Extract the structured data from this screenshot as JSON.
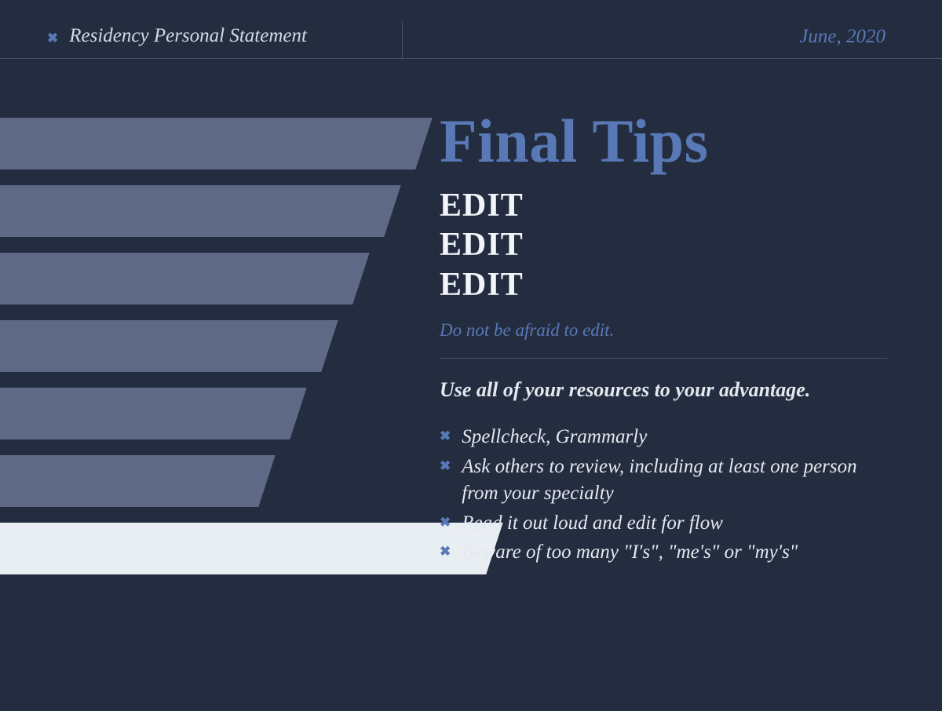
{
  "header": {
    "title": "Residency Personal Statement",
    "date": "June, 2020"
  },
  "main": {
    "title": "Final Tips",
    "edit_lines": [
      "EDIT",
      "EDIT",
      "EDIT"
    ],
    "note": "Do not be afraid to edit.",
    "lead": "Use all of your resources to your advantage.",
    "bullets": [
      "Spellcheck, Grammarly",
      "Ask others to review, including at least one person from your specialty",
      "Read it out loud and edit for flow",
      "Beware of too many \"I's\", \"me's\" or \"my's\""
    ]
  },
  "icons": {
    "x": "✖"
  }
}
